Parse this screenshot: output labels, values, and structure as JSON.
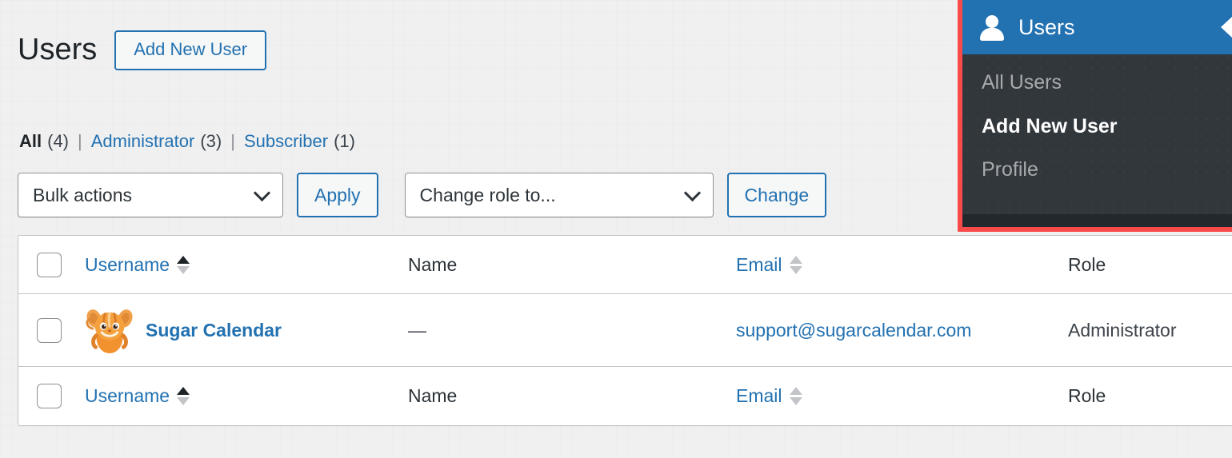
{
  "page": {
    "title": "Users",
    "add_new_label": "Add New User"
  },
  "filters": {
    "items": [
      {
        "label": "All",
        "count": "(4)",
        "current": true
      },
      {
        "label": "Administrator",
        "count": "(3)",
        "current": false
      },
      {
        "label": "Subscriber",
        "count": "(1)",
        "current": false
      }
    ],
    "separator": "|"
  },
  "tablenav": {
    "bulk_actions_value": "Bulk actions",
    "apply_label": "Apply",
    "change_role_value": "Change role to...",
    "change_label": "Change"
  },
  "table": {
    "columns": {
      "username": "Username",
      "name": "Name",
      "email": "Email",
      "role": "Role"
    },
    "rows": [
      {
        "username": "Sugar Calendar",
        "name": "—",
        "email": "support@sugarcalendar.com",
        "role": "Administrator"
      }
    ]
  },
  "admin_menu": {
    "title": "Users",
    "items": [
      {
        "label": "All Users",
        "active": false
      },
      {
        "label": "Add New User",
        "active": true
      },
      {
        "label": "Profile",
        "active": false
      }
    ]
  },
  "colors": {
    "link": "#2271b1",
    "menu_header": "#2271b1",
    "menu_background": "#32373c",
    "highlight_border": "#f94a4a",
    "page_background": "#f0f0f1"
  }
}
